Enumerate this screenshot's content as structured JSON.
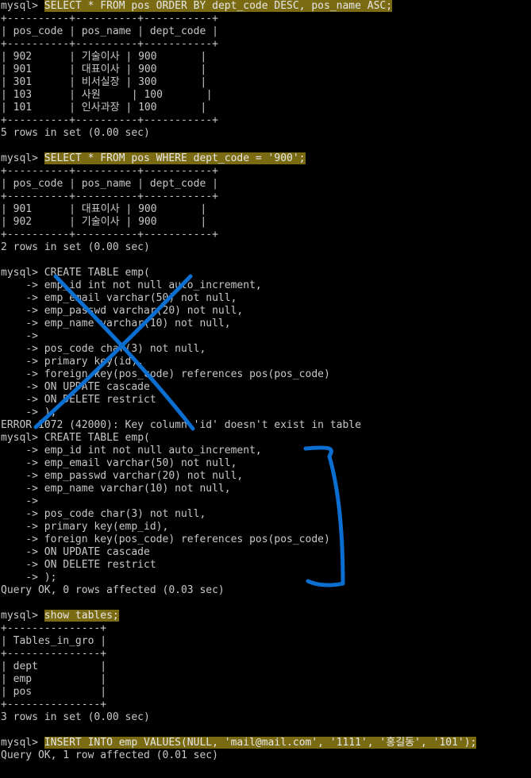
{
  "prompt": "mysql>",
  "annotation_color": "#0a6fd0",
  "highlight_color": "#7a6b12",
  "lines": [
    {
      "prompt": "mysql> ",
      "text": "SELECT * FROM pos ORDER BY dept_code DESC, pos_name ASC;",
      "highlight": true
    },
    {
      "text": "+----------+----------+-----------+"
    },
    {
      "text": "| pos_code | pos_name | dept_code |"
    },
    {
      "text": "+----------+----------+-----------+"
    },
    {
      "text": "| 902      | 기술이사 | 900       |"
    },
    {
      "text": "| 901      | 대표이사 | 900       |"
    },
    {
      "text": "| 301      | 비서실장 | 300       |"
    },
    {
      "text": "| 103      | 사원     | 100       |"
    },
    {
      "text": "| 101      | 인사과장 | 100       |"
    },
    {
      "text": "+----------+----------+-----------+"
    },
    {
      "text": "5 rows in set (0.00 sec)"
    },
    {
      "text": ""
    },
    {
      "prompt": "mysql> ",
      "text": "SELECT * FROM pos WHERE dept_code = '900';",
      "highlight": true
    },
    {
      "text": "+----------+----------+-----------+"
    },
    {
      "text": "| pos_code | pos_name | dept_code |"
    },
    {
      "text": "+----------+----------+-----------+"
    },
    {
      "text": "| 901      | 대표이사 | 900       |"
    },
    {
      "text": "| 902      | 기술이사 | 900       |"
    },
    {
      "text": "+----------+----------+-----------+"
    },
    {
      "text": "2 rows in set (0.00 sec)"
    },
    {
      "text": ""
    },
    {
      "prompt": "mysql> ",
      "text": "CREATE TABLE emp("
    },
    {
      "text": "    -> emp_id int not null auto_increment,"
    },
    {
      "text": "    -> emp_email varchar(50) not null,"
    },
    {
      "text": "    -> emp_passwd varchar(20) not null,"
    },
    {
      "text": "    -> emp_name varchar(10) not null,"
    },
    {
      "text": "    ->"
    },
    {
      "text": "    -> pos_code char(3) not null,"
    },
    {
      "text": "    -> primary key(id),"
    },
    {
      "text": "    -> foreign key(pos_code) references pos(pos_code)"
    },
    {
      "text": "    -> ON UPDATE cascade"
    },
    {
      "text": "    -> ON DELETE restrict"
    },
    {
      "text": "    -> );"
    },
    {
      "text": "ERROR 1072 (42000): Key column 'id' doesn't exist in table"
    },
    {
      "prompt": "mysql> ",
      "text": "CREATE TABLE emp("
    },
    {
      "text": "    -> emp_id int not null auto_increment,"
    },
    {
      "text": "    -> emp_email varchar(50) not null,"
    },
    {
      "text": "    -> emp_passwd varchar(20) not null,"
    },
    {
      "text": "    -> emp_name varchar(10) not null,"
    },
    {
      "text": "    ->"
    },
    {
      "text": "    -> pos_code char(3) not null,"
    },
    {
      "text": "    -> primary key(emp_id),"
    },
    {
      "text": "    -> foreign key(pos_code) references pos(pos_code)"
    },
    {
      "text": "    -> ON UPDATE cascade"
    },
    {
      "text": "    -> ON DELETE restrict"
    },
    {
      "text": "    -> );"
    },
    {
      "text": "Query OK, 0 rows affected (0.03 sec)"
    },
    {
      "text": ""
    },
    {
      "prompt": "mysql> ",
      "text": "show tables;",
      "highlight": true
    },
    {
      "text": "+---------------+"
    },
    {
      "text": "| Tables_in_gro |"
    },
    {
      "text": "+---------------+"
    },
    {
      "text": "| dept          |"
    },
    {
      "text": "| emp           |"
    },
    {
      "text": "| pos           |"
    },
    {
      "text": "+---------------+"
    },
    {
      "text": "3 rows in set (0.00 sec)"
    },
    {
      "text": ""
    },
    {
      "prompt": "mysql> ",
      "text": "INSERT INTO emp VALUES(NULL, 'mail@mail.com', '1111', '홍길동', '101');",
      "highlight": true
    },
    {
      "text": "Query OK, 1 row affected (0.01 sec)"
    }
  ]
}
